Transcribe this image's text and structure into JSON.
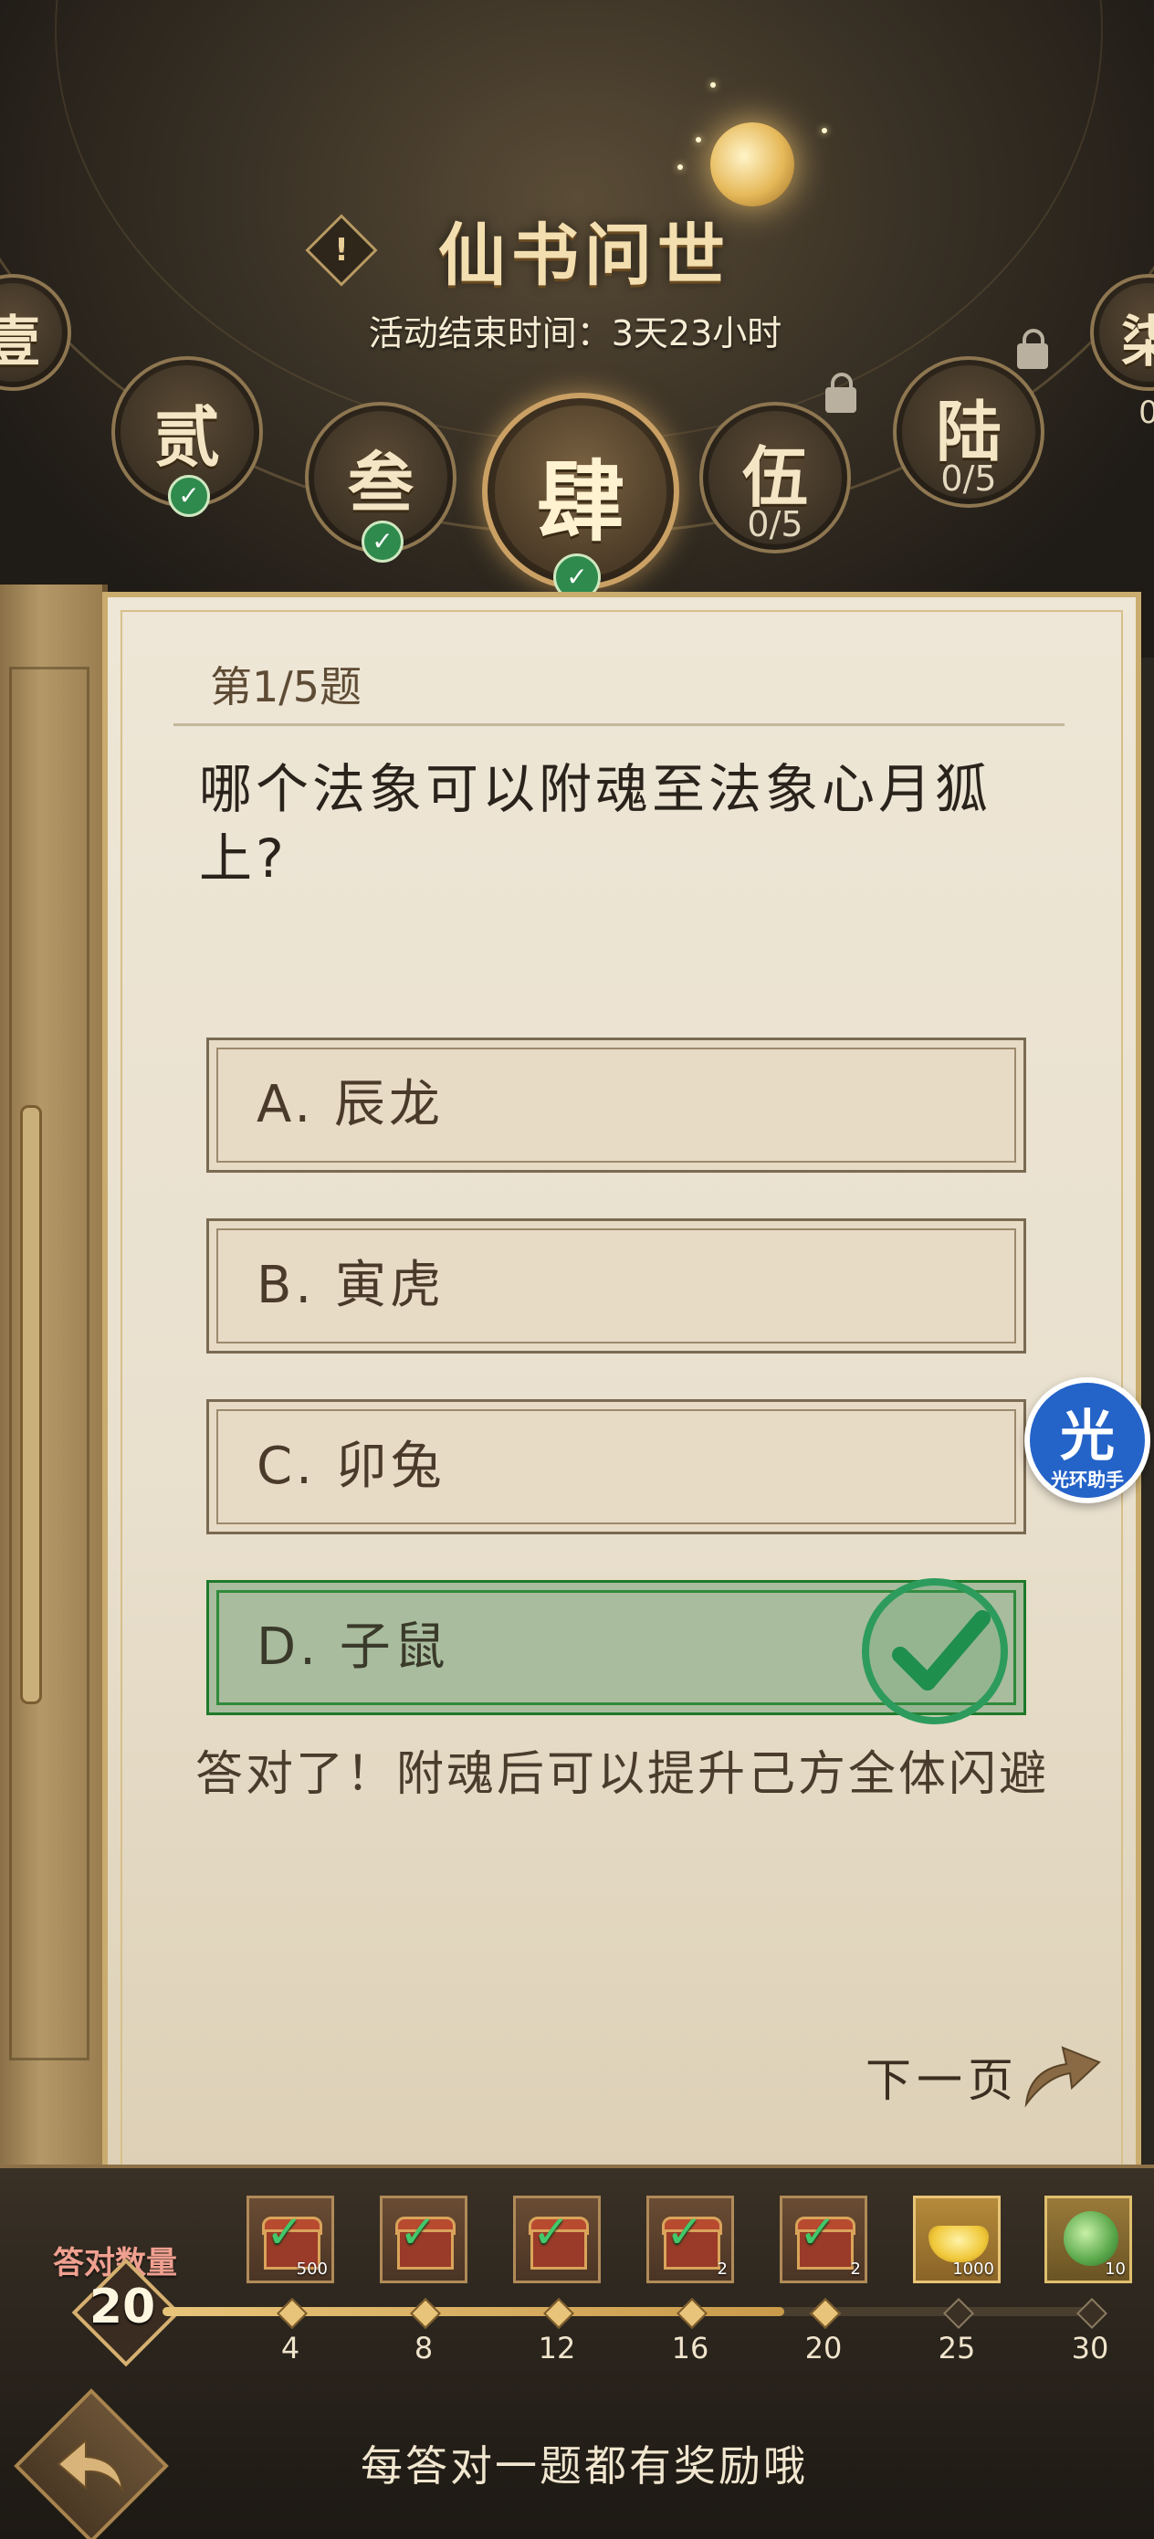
{
  "header": {
    "title": "仙书问世",
    "deadline": "活动结束时间：3天23小时",
    "tabs": [
      {
        "glyph": "壹",
        "progress": "",
        "status": "done"
      },
      {
        "glyph": "贰",
        "progress": "",
        "status": "done"
      },
      {
        "glyph": "叁",
        "progress": "",
        "status": "done"
      },
      {
        "glyph": "肆",
        "progress": "",
        "status": "active-done"
      },
      {
        "glyph": "伍",
        "progress": "0/5",
        "status": "locked"
      },
      {
        "glyph": "陆",
        "progress": "0/5",
        "status": "locked"
      },
      {
        "glyph": "柒",
        "progress": "0",
        "status": "locked"
      }
    ]
  },
  "quiz": {
    "number": "第1/5题",
    "question": "哪个法象可以附魂至法象心月狐上?",
    "options": [
      {
        "text": "A. 辰龙",
        "state": "normal"
      },
      {
        "text": "B. 寅虎",
        "state": "normal"
      },
      {
        "text": "C. 卯兔",
        "state": "normal"
      },
      {
        "text": "D. 子鼠",
        "state": "correct"
      }
    ],
    "feedback": "答对了！附魂后可以提升己方全体闪避",
    "next_label": "下一页"
  },
  "assistant": {
    "big": "光",
    "small": "光环助手"
  },
  "rewards": {
    "correct_label": "答对数量",
    "count": "20",
    "progress_fraction": 0.67,
    "milestones": [
      "4",
      "8",
      "12",
      "16",
      "20",
      "25",
      "30"
    ],
    "items": [
      {
        "icon": "chest-checked-icon",
        "qty": "500"
      },
      {
        "icon": "chest-checked-icon",
        "qty": ""
      },
      {
        "icon": "chest-checked-icon",
        "qty": ""
      },
      {
        "icon": "chest-checked-icon",
        "qty": "2"
      },
      {
        "icon": "chest-checked-icon",
        "qty": "2"
      },
      {
        "icon": "gold-ingot-icon",
        "qty": "1000"
      },
      {
        "icon": "jade-token-icon",
        "qty": "10"
      }
    ],
    "tip": "每答对一题都有奖励哦"
  },
  "colors": {
    "correct_green": "#2f8a3a",
    "gold": "#d6b070",
    "paper": "#eee6d6"
  }
}
